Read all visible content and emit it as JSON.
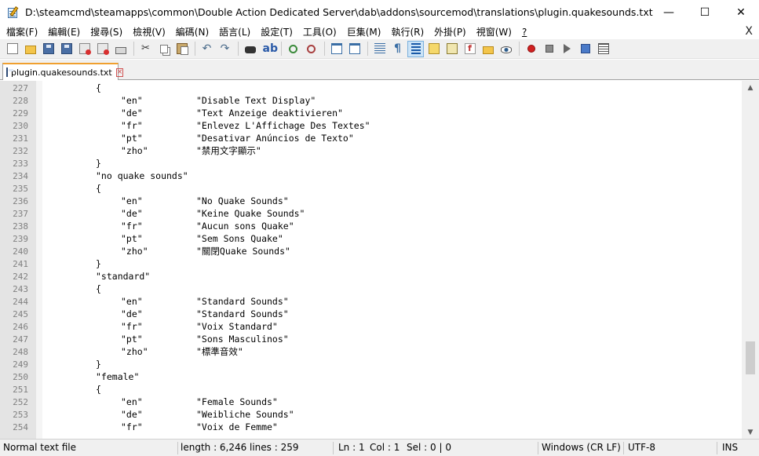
{
  "window": {
    "title": "D:\\steamcmd\\steamapps\\common\\Double Action Dedicated Server\\dab\\addons\\sourcemod\\translations\\plugin.quakesounds.txt - Notep...",
    "minimize": "—",
    "maximize": "☐",
    "close": "✕"
  },
  "menu": {
    "items": [
      "檔案(F)",
      "編輯(E)",
      "搜尋(S)",
      "檢視(V)",
      "編碼(N)",
      "語言(L)",
      "設定(T)",
      "工具(O)",
      "巨集(M)",
      "執行(R)",
      "外掛(P)",
      "視窗(W)",
      "?"
    ],
    "close": "X"
  },
  "toolbar": {
    "icons": [
      "new-file-icon",
      "open-file-icon",
      "save-icon",
      "save-all-icon",
      "close-icon",
      "close-all-icon",
      "print-icon",
      "cut-icon",
      "copy-icon",
      "paste-icon",
      "undo-icon",
      "redo-icon",
      "find-icon",
      "replace-icon",
      "zoom-in-icon",
      "zoom-out-icon",
      "sync-vertical-icon",
      "sync-horizontal-icon",
      "word-wrap-icon",
      "show-all-chars-icon",
      "indent-guide-icon",
      "user-language-icon",
      "doc-map-icon",
      "function-list-icon",
      "folder-workspace-icon",
      "monitoring-icon",
      "record-macro-icon",
      "stop-macro-icon",
      "play-macro-icon",
      "run-macro-multiple-icon",
      "save-macro-icon"
    ]
  },
  "tab": {
    "label": "plugin.quakesounds.txt",
    "close": "×"
  },
  "editor": {
    "lines": [
      {
        "n": "227",
        "indent": 1,
        "text": "{"
      },
      {
        "n": "228",
        "key": "\"en\"",
        "val": "\"Disable Text Display\""
      },
      {
        "n": "229",
        "key": "\"de\"",
        "val": "\"Text Anzeige deaktivieren\""
      },
      {
        "n": "230",
        "key": "\"fr\"",
        "val": "\"Enlevez L'Affichage Des Textes\""
      },
      {
        "n": "231",
        "key": "\"pt\"",
        "val": "\"Desativar Anúncios de Texto\""
      },
      {
        "n": "232",
        "key": "\"zho\"",
        "val": "\"禁用文字顯示\""
      },
      {
        "n": "233",
        "indent": 1,
        "text": "}"
      },
      {
        "n": "234",
        "indent": 1,
        "text": "\"no quake sounds\""
      },
      {
        "n": "235",
        "indent": 1,
        "text": "{"
      },
      {
        "n": "236",
        "key": "\"en\"",
        "val": "\"No Quake Sounds\""
      },
      {
        "n": "237",
        "key": "\"de\"",
        "val": "\"Keine Quake Sounds\""
      },
      {
        "n": "238",
        "key": "\"fr\"",
        "val": "\"Aucun sons Quake\""
      },
      {
        "n": "239",
        "key": "\"pt\"",
        "val": "\"Sem Sons Quake\""
      },
      {
        "n": "240",
        "key": "\"zho\"",
        "val": "\"關閉Quake Sounds\""
      },
      {
        "n": "241",
        "indent": 1,
        "text": "}"
      },
      {
        "n": "242",
        "indent": 1,
        "text": "\"standard\""
      },
      {
        "n": "243",
        "indent": 1,
        "text": "{"
      },
      {
        "n": "244",
        "key": "\"en\"",
        "val": "\"Standard Sounds\""
      },
      {
        "n": "245",
        "key": "\"de\"",
        "val": "\"Standard Sounds\""
      },
      {
        "n": "246",
        "key": "\"fr\"",
        "val": "\"Voix Standard\""
      },
      {
        "n": "247",
        "key": "\"pt\"",
        "val": "\"Sons Masculinos\""
      },
      {
        "n": "248",
        "key": "\"zho\"",
        "val": "\"標準音效\""
      },
      {
        "n": "249",
        "indent": 1,
        "text": "}"
      },
      {
        "n": "250",
        "indent": 1,
        "text": "\"female\""
      },
      {
        "n": "251",
        "indent": 1,
        "text": "{"
      },
      {
        "n": "252",
        "key": "\"en\"",
        "val": "\"Female Sounds\""
      },
      {
        "n": "253",
        "key": "\"de\"",
        "val": "\"Weibliche Sounds\""
      },
      {
        "n": "254",
        "key": "\"fr\"",
        "val": "\"Voix de Femme\""
      }
    ]
  },
  "scrollbar": {
    "up": "▲",
    "down": "▼",
    "position_fraction": 0.83,
    "thumb_fraction": 0.1
  },
  "status": {
    "type": "Normal text file",
    "length": "length : 6,246",
    "lines": "lines : 259",
    "ln": "Ln : 1",
    "col": "Col : 1",
    "sel": "Sel : 0 | 0",
    "eol": "Windows (CR LF)",
    "encoding": "UTF-8",
    "mode": "INS"
  },
  "colors": {
    "tab_accent": "#f0a030",
    "gutter": "#e4e4e4",
    "line_number": "#808080"
  }
}
